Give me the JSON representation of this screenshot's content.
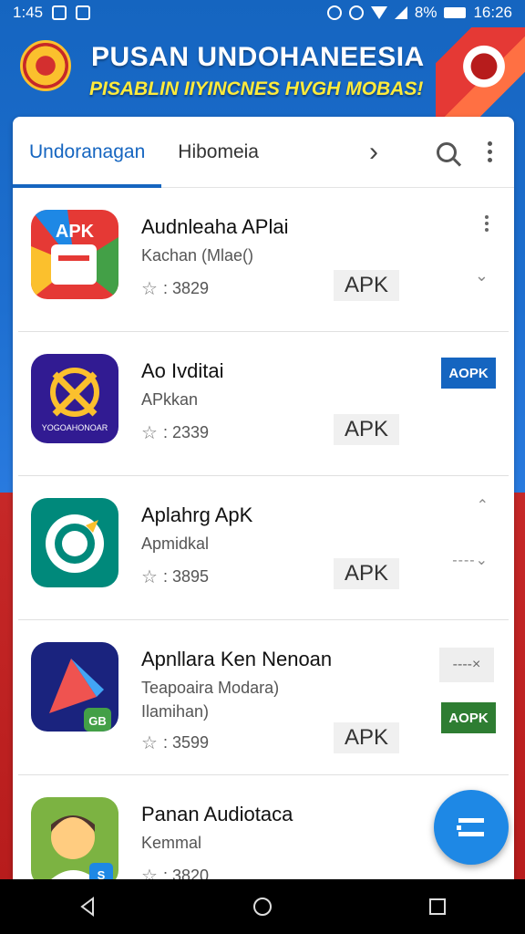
{
  "status_bar": {
    "time_left": "1:45",
    "battery": "8%",
    "time_right": "16:26"
  },
  "banner": {
    "title": "PUSAN UNDOHANEESIA",
    "subtitle": "PISABLIN IIYINCNES HVGH MOBAS!"
  },
  "tabs": {
    "active": "Undoranagan",
    "inactive": "Hibomeia"
  },
  "apps": [
    {
      "name": "Audnleaha APlai",
      "subtitle": "Kachan (Mlae()",
      "rating": ": 3829",
      "apk": "APK"
    },
    {
      "name": "Ao Ivditai",
      "subtitle": "APkkan",
      "rating": ": 2339",
      "apk": "APK",
      "badge": "AOPK"
    },
    {
      "name": "Aplahrg ApK",
      "subtitle": "Apmidkal",
      "rating": ": 3895",
      "apk": "APK",
      "side_label": "----",
      "icon_letter": ""
    },
    {
      "name": "Apnllara Ken Nenoan",
      "subtitle": "Teapoaira Modara)",
      "subtitle2": "Ilamihan)",
      "rating": ": 3599",
      "apk": "APK",
      "close_label": "----×",
      "badge": "AOPK",
      "icon_tag": "GB"
    },
    {
      "name": "Panan Audiotaca",
      "subtitle": "Kemmal",
      "rating": ": 3820",
      "icon_tag": "S"
    }
  ],
  "icon_text": {
    "app1": "APK",
    "app2": "YOGOAHONOAR"
  },
  "colors": {
    "accent": "#1565c0",
    "fab": "#1e88e5",
    "badge_green": "#2e7d32"
  }
}
